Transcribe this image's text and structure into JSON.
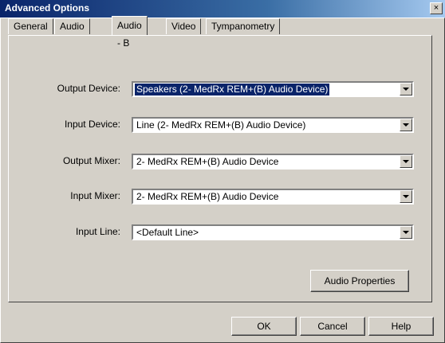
{
  "window": {
    "title": "Advanced Options",
    "close_glyph": "×"
  },
  "tabs": [
    {
      "label": "General"
    },
    {
      "label": "Audio - A"
    },
    {
      "label": "Audio - B",
      "active": true
    },
    {
      "label": "Video"
    },
    {
      "label": "Tympanometry"
    }
  ],
  "fields": [
    {
      "label": "Output Device:",
      "value": "Speakers (2- MedRx REM+(B) Audio Device)",
      "selected": true
    },
    {
      "label": "Input Device:",
      "value": "Line (2- MedRx REM+(B) Audio Device)"
    },
    {
      "label": "Output Mixer:",
      "value": "2- MedRx REM+(B) Audio Device"
    },
    {
      "label": "Input Mixer:",
      "value": "2- MedRx REM+(B) Audio Device"
    },
    {
      "label": "Input Line:",
      "value": "<Default Line>"
    }
  ],
  "buttons": {
    "audio_properties": "Audio Properties",
    "ok": "OK",
    "cancel": "Cancel",
    "help": "Help"
  }
}
